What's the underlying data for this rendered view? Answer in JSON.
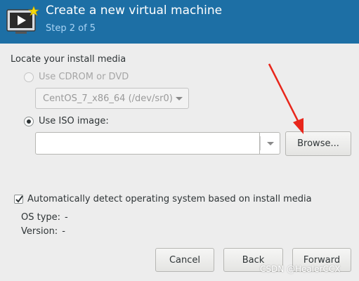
{
  "header": {
    "title": "Create a new virtual machine",
    "step": "Step 2 of 5",
    "icon": "virtual-machine-icon"
  },
  "install_media": {
    "section_label": "Locate your install media",
    "cdrom_option": {
      "label": "Use CDROM or DVD",
      "selected": false,
      "disabled": true
    },
    "cdrom_device": {
      "value": "CentOS_7_x86_64 (/dev/sr0)",
      "disabled": true
    },
    "iso_option": {
      "label": "Use ISO image:",
      "selected": true
    },
    "iso_path": {
      "value": ""
    },
    "browse_button": "Browse..."
  },
  "os_detection": {
    "auto_detect_label": "Automatically detect operating system based on install media",
    "auto_detect_checked": true,
    "os_type_label": "OS type:",
    "os_type_value": "-",
    "version_label": "Version:",
    "version_value": "-"
  },
  "footer": {
    "cancel": "Cancel",
    "back": "Back",
    "forward": "Forward"
  },
  "annotation": {
    "arrow_color": "#e8261b"
  },
  "watermark": "CSDN @HealerCCX",
  "colors": {
    "header_bg": "#1d6fa5",
    "window_bg": "#ededed"
  }
}
